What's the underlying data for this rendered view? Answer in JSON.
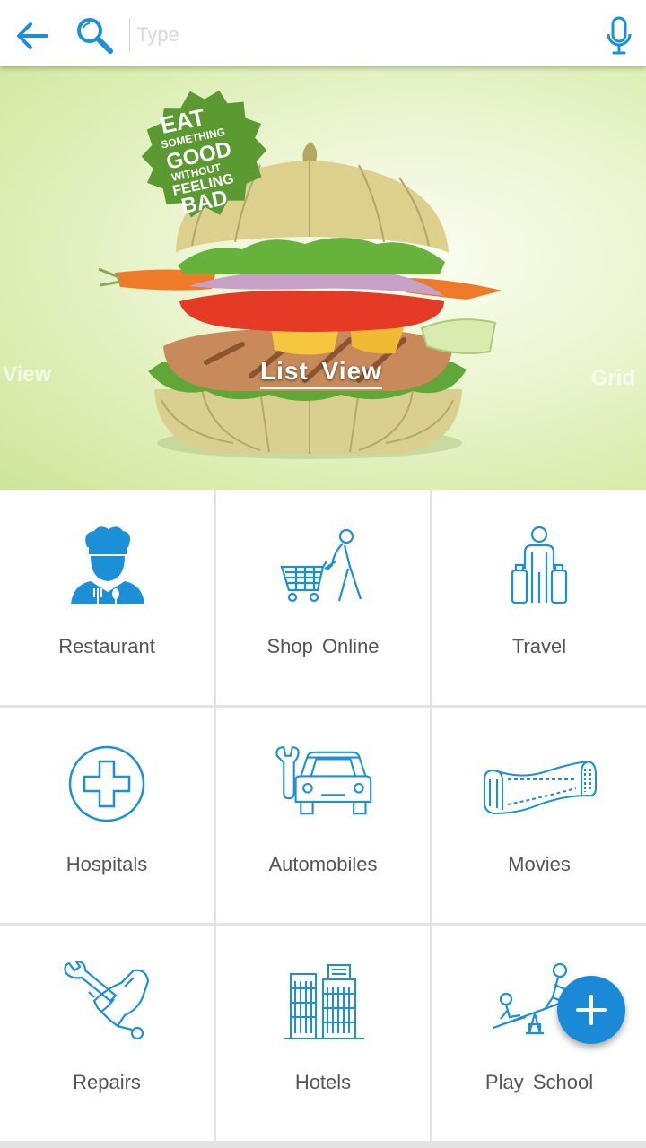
{
  "topbar": {
    "search_placeholder": "Type",
    "icons": [
      "back-arrow-icon",
      "search-icon",
      "microphone-icon"
    ]
  },
  "banner": {
    "center_label": "List View",
    "left_label": "View",
    "right_label": "Grid",
    "poster_text": [
      "EAT",
      "SOMETHING",
      "GOOD",
      "WITHOUT",
      "FEELING",
      "BAD"
    ]
  },
  "categories": [
    {
      "label": "Restaurant",
      "icon": "chef-icon"
    },
    {
      "label": "Shop  Online",
      "icon": "shopping-cart-icon"
    },
    {
      "label": "Travel",
      "icon": "traveler-luggage-icon"
    },
    {
      "label": "Hospitals",
      "icon": "medical-cross-icon"
    },
    {
      "label": "Automobiles",
      "icon": "car-wrench-icon"
    },
    {
      "label": "Movies",
      "icon": "film-reel-icon"
    },
    {
      "label": "Repairs",
      "icon": "repair-tools-icon"
    },
    {
      "label": "Hotels",
      "icon": "hotel-building-icon"
    },
    {
      "label": "Play  School",
      "icon": "seesaw-icon"
    }
  ],
  "fab": {
    "icon": "plus-icon"
  },
  "colors": {
    "accent": "#1a8ad6",
    "icon_blue": "#1b8fd8",
    "label_gray": "#555555",
    "divider": "#e3e3e3"
  }
}
